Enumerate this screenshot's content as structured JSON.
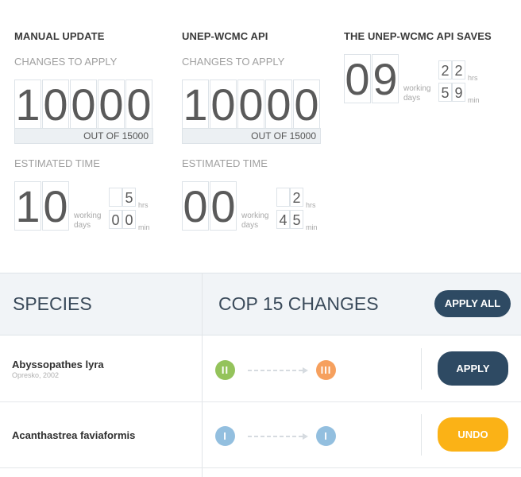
{
  "manual": {
    "title": "MANUAL UPDATE",
    "changes_label": "CHANGES TO APPLY",
    "changes_digits": [
      "1",
      "0",
      "0",
      "0",
      "0"
    ],
    "out_of": "OUT OF 15000",
    "time_label": "ESTIMATED TIME",
    "days_digits": [
      "1",
      "0"
    ],
    "hrs_digits": [
      "",
      "5"
    ],
    "min_digits": [
      "0",
      "0"
    ],
    "days_unit": "working days",
    "hrs_unit": "hrs",
    "min_unit": "min"
  },
  "api": {
    "title": "UNEP-WCMC API",
    "changes_label": "CHANGES TO APPLY",
    "changes_digits": [
      "1",
      "0",
      "0",
      "0",
      "0"
    ],
    "out_of": "OUT OF 15000",
    "time_label": "ESTIMATED TIME",
    "days_digits": [
      "0",
      "0"
    ],
    "hrs_digits": [
      "",
      "2"
    ],
    "min_digits": [
      "4",
      "5"
    ],
    "days_unit": "working days",
    "hrs_unit": "hrs",
    "min_unit": "min"
  },
  "saves": {
    "title": "THE UNEP-WCMC API SAVES",
    "days_digits": [
      "0",
      "9"
    ],
    "hrs_digits": [
      "2",
      "2"
    ],
    "min_digits": [
      "5",
      "9"
    ],
    "days_unit": "working days",
    "hrs_unit": "hrs",
    "min_unit": "min"
  },
  "table": {
    "species_header": "SPECIES",
    "changes_header": "COP 15 CHANGES",
    "apply_all": "APPLY ALL",
    "rows": [
      {
        "name": "Abyssopathes lyra",
        "author": "Opresko, 2002",
        "from": "II",
        "to": "III",
        "action": "APPLY"
      },
      {
        "name": "Acanthastrea faviaformis",
        "author": "",
        "from": "I",
        "to": "I",
        "action": "UNDO"
      }
    ]
  },
  "colors": {
    "navy": "#2e4a63",
    "orange_button": "#fbb216",
    "appendix_I": "#93bfdf",
    "appendix_II": "#94c35b",
    "appendix_III": "#f6a05e"
  },
  "icons": [
    "dashed-arrow-icon"
  ]
}
